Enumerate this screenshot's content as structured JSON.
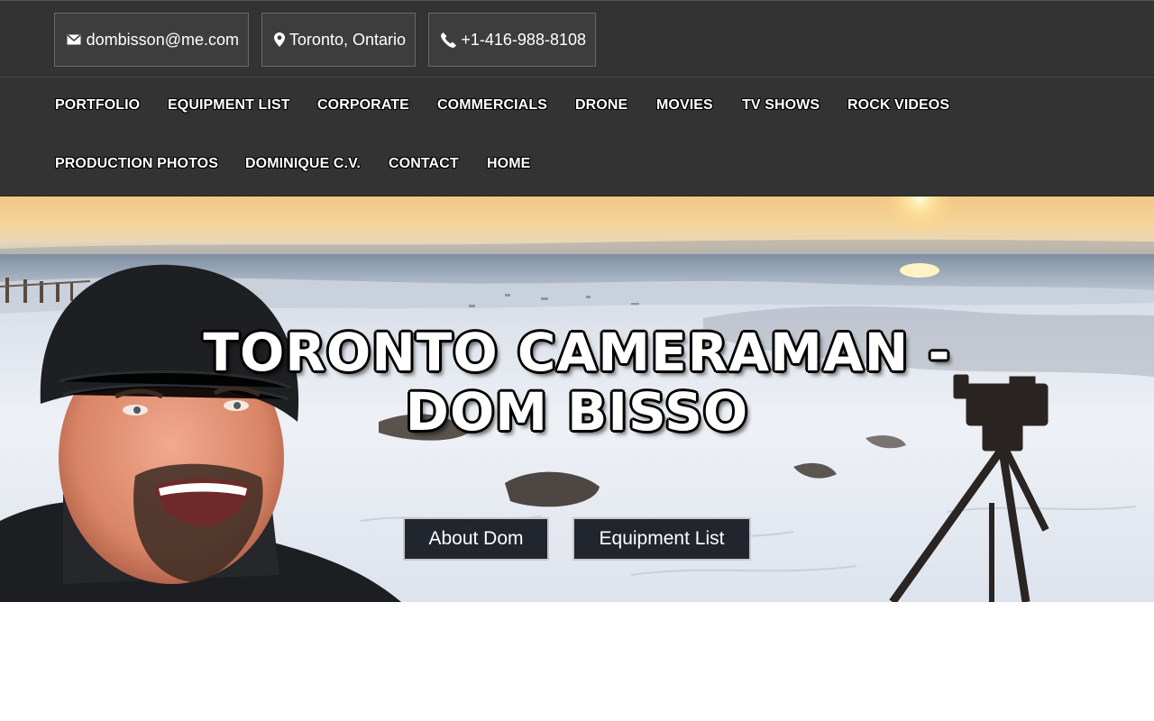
{
  "contact": {
    "email": "dombisson@me.com",
    "location": "Toronto, Ontario",
    "phone": "+1-416-988-8108"
  },
  "icons": {
    "email": "envelope-icon",
    "location": "map-pin-icon",
    "phone": "phone-icon"
  },
  "nav": {
    "items": [
      "PORTFOLIO",
      "EQUIPMENT LIST",
      "CORPORATE",
      "COMMERCIALS",
      "DRONE",
      "MOVIES",
      "TV SHOWS",
      "ROCK VIDEOS",
      "PRODUCTION PHOTOS",
      "DOMINIQUE C.V.",
      "CONTACT",
      "HOME"
    ]
  },
  "hero": {
    "title": "TORONTO CAMERAMAN - DOM BISSO",
    "buttons": {
      "about": "About Dom",
      "equipment": "Equipment List"
    }
  },
  "colors": {
    "bar_background": "#333333",
    "contact_box": "#3d3d3d",
    "button_background": "#12161e",
    "text": "#ffffff"
  }
}
